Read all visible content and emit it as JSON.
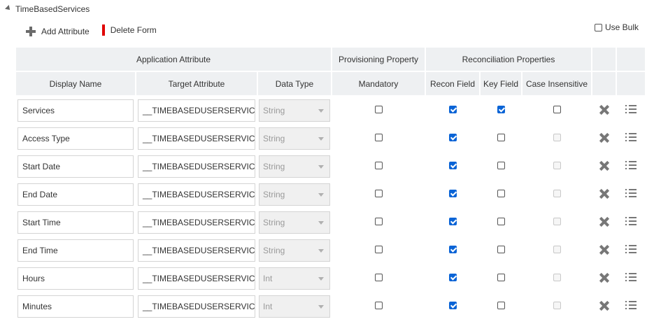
{
  "section": {
    "title": "TimeBasedServices"
  },
  "toolbar": {
    "add_attribute": "Add Attribute",
    "delete_form": "Delete Form"
  },
  "use_bulk": {
    "label": "Use Bulk",
    "checked": false
  },
  "table": {
    "group_headers": {
      "application_attribute": "Application Attribute",
      "provisioning_property": "Provisioning Property",
      "reconciliation_properties": "Reconciliation Properties"
    },
    "columns": {
      "display_name": "Display Name",
      "target_attribute": "Target Attribute",
      "data_type": "Data Type",
      "mandatory": "Mandatory",
      "recon_field": "Recon Field",
      "key_field": "Key Field",
      "case_insensitive": "Case Insensitive"
    },
    "rows": [
      {
        "display_name": "Services",
        "target_attribute": "__TIMEBASEDUSERSERVICE__.",
        "data_type": "String",
        "mandatory": false,
        "recon_field": true,
        "key_field": true,
        "case_insensitive": false,
        "case_insensitive_disabled": false
      },
      {
        "display_name": "Access Type",
        "target_attribute": "__TIMEBASEDUSERSERVICE__.",
        "data_type": "String",
        "mandatory": false,
        "recon_field": true,
        "key_field": false,
        "case_insensitive": false,
        "case_insensitive_disabled": true
      },
      {
        "display_name": "Start Date",
        "target_attribute": "__TIMEBASEDUSERSERVICE__.",
        "data_type": "String",
        "mandatory": false,
        "recon_field": true,
        "key_field": false,
        "case_insensitive": false,
        "case_insensitive_disabled": true
      },
      {
        "display_name": "End Date",
        "target_attribute": "__TIMEBASEDUSERSERVICE__.",
        "data_type": "String",
        "mandatory": false,
        "recon_field": true,
        "key_field": false,
        "case_insensitive": false,
        "case_insensitive_disabled": true
      },
      {
        "display_name": "Start Time",
        "target_attribute": "__TIMEBASEDUSERSERVICE__.",
        "data_type": "String",
        "mandatory": false,
        "recon_field": true,
        "key_field": false,
        "case_insensitive": false,
        "case_insensitive_disabled": true
      },
      {
        "display_name": "End Time",
        "target_attribute": "__TIMEBASEDUSERSERVICE__.",
        "data_type": "String",
        "mandatory": false,
        "recon_field": true,
        "key_field": false,
        "case_insensitive": false,
        "case_insensitive_disabled": true
      },
      {
        "display_name": "Hours",
        "target_attribute": "__TIMEBASEDUSERSERVICE__.",
        "data_type": "Int",
        "mandatory": false,
        "recon_field": true,
        "key_field": false,
        "case_insensitive": false,
        "case_insensitive_disabled": true
      },
      {
        "display_name": "Minutes",
        "target_attribute": "__TIMEBASEDUSERSERVICE__.",
        "data_type": "Int",
        "mandatory": false,
        "recon_field": true,
        "key_field": false,
        "case_insensitive": false,
        "case_insensitive_disabled": true
      }
    ]
  },
  "icons": {
    "delete": "close-icon",
    "details": "list-icon",
    "add": "plus-icon",
    "collapse": "triangle-down-icon"
  },
  "colors": {
    "checked": "#0a64d6",
    "delete_bar": "#e00000",
    "header_bg": "#eef0f2"
  }
}
